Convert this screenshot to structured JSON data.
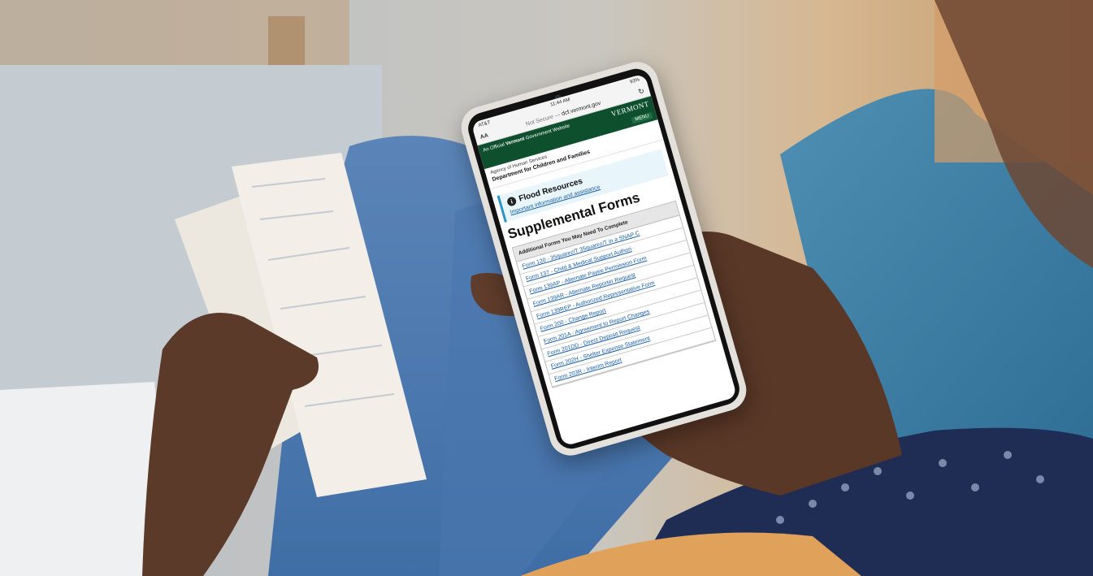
{
  "status_bar": {
    "carrier": "AT&T",
    "time": "11:44 AM",
    "battery": "93%"
  },
  "url_bar": {
    "text_size": "AA",
    "security": "Not Secure —",
    "domain": "dcf.vermont.gov"
  },
  "gov_header": {
    "official_prefix": "An Official",
    "official_state": "Vermont",
    "official_suffix": "Government Website",
    "logo_text": "VERMONT",
    "menu_label": "MENU"
  },
  "agency": {
    "name": "Agency of Human Services",
    "department": "Department for Children and Families"
  },
  "alert": {
    "title": "Flood Resources",
    "link": "Important information and assistance"
  },
  "page": {
    "title": "Supplemental Forms"
  },
  "forms_table": {
    "header": "Additional Forms You May Need To Complete",
    "rows": [
      "Form 120 - 35quarez/T 35quarez/T in a SNAP C",
      "Form 137 - Child & Medical Support Authori",
      "Form 139AP - Alternate Payee Permission Form",
      "Form 139AR - Alternate Reporter Request",
      "Form 139REP - Authorized Representative Form",
      "Form 200 - Change Report",
      "Form 201A - Agreement to Report Changes",
      "Form 201DD - Direct Deposit Request",
      "Form 202H - Shelter Expense Statement",
      "Form 203R - Interim Report"
    ]
  }
}
